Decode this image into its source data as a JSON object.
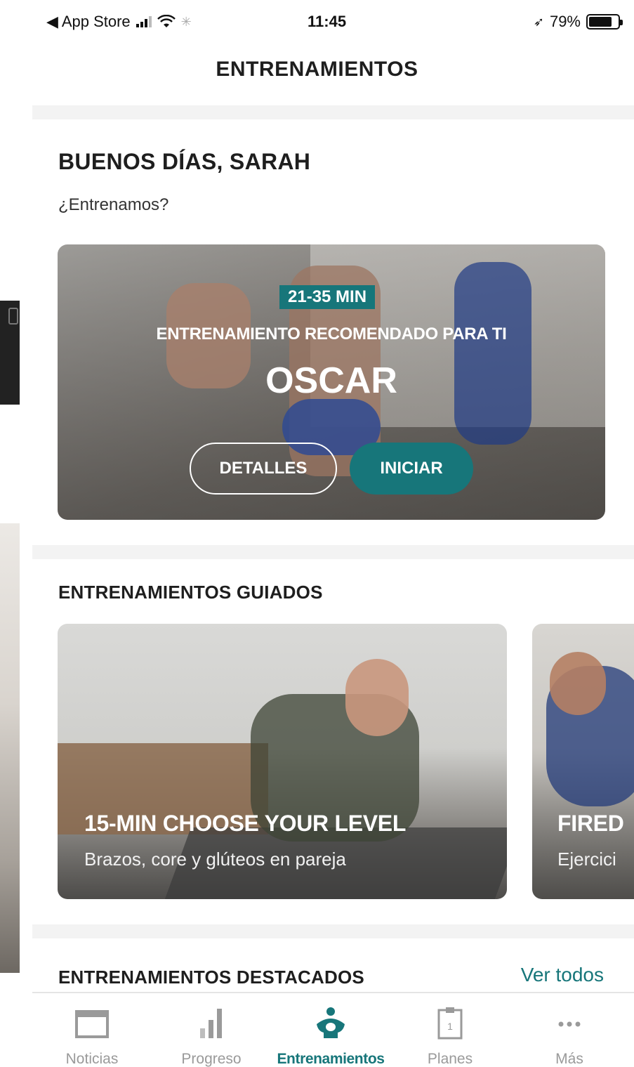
{
  "status_bar": {
    "back_app": "◀ App Store",
    "time": "11:45",
    "battery": "79%",
    "battery_level": 0.79
  },
  "header": {
    "title": "ENTRENAMIENTOS"
  },
  "greeting": {
    "title": "BUENOS DÍAS, SARAH",
    "subtitle": "¿Entrenamos?"
  },
  "recommended": {
    "duration_badge": "21-35 MIN",
    "caption": "ENTRENAMIENTO RECOMENDADO PARA TI",
    "name": "OSCAR",
    "details_label": "DETALLES",
    "start_label": "INICIAR"
  },
  "guided": {
    "section_title": "ENTRENAMIENTOS GUIADOS",
    "cards": [
      {
        "title": "15-MIN CHOOSE YOUR LEVEL",
        "subtitle": "Brazos, core y glúteos en pareja"
      },
      {
        "title": "FIRED",
        "subtitle": "Ejercici"
      }
    ]
  },
  "featured": {
    "section_title": "ENTRENAMIENTOS DESTACADOS",
    "see_all": "Ver todos"
  },
  "tabbar": {
    "items": [
      {
        "label": "Noticias",
        "icon": "news-icon"
      },
      {
        "label": "Progreso",
        "icon": "progress-chart-icon"
      },
      {
        "label": "Entrenamientos",
        "icon": "workout-person-icon"
      },
      {
        "label": "Planes",
        "icon": "calendar-plans-icon",
        "icon_text": "1"
      },
      {
        "label": "Más",
        "icon": "more-dots-icon"
      }
    ]
  },
  "colors": {
    "accent": "#17767a",
    "tab_inactive": "#9a9a9a",
    "text": "#1e1e1e"
  }
}
